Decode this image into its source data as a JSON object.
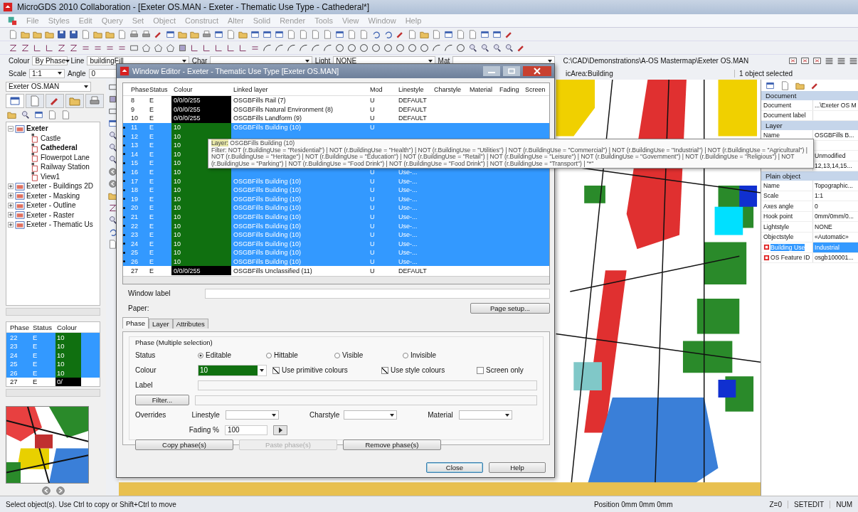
{
  "window": {
    "title": "MicroGDS 2010 Collaboration - [Exeter OS.MAN - Exeter - Thematic Use Type - Cathederal*]"
  },
  "menu": [
    {
      "label": "File",
      "disabled": true
    },
    {
      "label": "Styles",
      "disabled": true
    },
    {
      "label": "Edit",
      "disabled": true
    },
    {
      "label": "Query",
      "disabled": true
    },
    {
      "label": "Set",
      "disabled": true
    },
    {
      "label": "Object",
      "disabled": true
    },
    {
      "label": "Construct",
      "disabled": true
    },
    {
      "label": "Alter",
      "disabled": true
    },
    {
      "label": "Solid",
      "disabled": true
    },
    {
      "label": "Render",
      "disabled": true
    },
    {
      "label": "Tools",
      "disabled": true
    },
    {
      "label": "View",
      "disabled": true
    },
    {
      "label": "Window",
      "disabled": true
    },
    {
      "label": "Help",
      "disabled": true
    }
  ],
  "property_bar": {
    "colour_label": "Colour",
    "colour": "By Phase",
    "line_label": "Line",
    "line": "buildingFill",
    "char_label": "Char",
    "light_label": "Light",
    "light": "NONE",
    "mat_label": "Mat",
    "path": "C:\\CAD\\Demonstrations\\A-OS Mastermap\\Exeter OS.MAN",
    "scale_label": "Scale",
    "scale": "1:1",
    "angle_label": "Angle",
    "angle": "0",
    "context": "icArea:Building",
    "selection": "1 object selected"
  },
  "left_panel": {
    "document": "Exeter OS.MAN",
    "tree": [
      {
        "label": "Exeter",
        "active": true,
        "expanded": true,
        "children": [
          {
            "label": "Castle",
            "active": false
          },
          {
            "label": "Cathederal",
            "active": true
          },
          {
            "label": "Flowerpot Lane",
            "active": false
          },
          {
            "label": "Railway Station",
            "active": false
          },
          {
            "label": "View1",
            "active": false
          }
        ]
      },
      {
        "label": "Exeter - Buildings 2D",
        "active": false,
        "expanded": false
      },
      {
        "label": "Exeter - Masking",
        "active": false,
        "expanded": false
      },
      {
        "label": "Exeter - Outline",
        "active": false,
        "expanded": false
      },
      {
        "label": "Exeter - Raster",
        "active": false,
        "expanded": false
      },
      {
        "label": "Exeter - Thematic Us",
        "active": false,
        "expanded": false
      }
    ]
  },
  "phase_list": {
    "columns": [
      "Phase",
      "Status",
      "Colour"
    ],
    "rows": [
      {
        "phase": "22",
        "status": "E",
        "colour": "10",
        "color": "#107010",
        "selected": true
      },
      {
        "phase": "23",
        "status": "E",
        "colour": "10",
        "color": "#107010",
        "selected": true
      },
      {
        "phase": "24",
        "status": "E",
        "colour": "10",
        "color": "#107010",
        "selected": true
      },
      {
        "phase": "25",
        "status": "E",
        "colour": "10",
        "color": "#107010",
        "selected": true
      },
      {
        "phase": "26",
        "status": "E",
        "colour": "10",
        "color": "#107010",
        "selected": true
      },
      {
        "phase": "27",
        "status": "E",
        "colour": "0/",
        "color": "#000000",
        "selected": false
      }
    ]
  },
  "dialog": {
    "title": "Window Editor - Exeter - Thematic Use Type [Exeter OS.MAN]",
    "columns": [
      "Phase",
      "Status",
      "Colour",
      "Linked layer",
      "Mod",
      "Linestyle",
      "Charstyle",
      "Material",
      "Fading",
      "Screen"
    ],
    "rows": [
      {
        "phase": "8",
        "status": "E",
        "colour": "0/0/0/255",
        "color": "#000000",
        "layer": "OSGBFills Rail (7)",
        "mod": "U",
        "linestyle": "DEFAULT",
        "selected": false
      },
      {
        "phase": "9",
        "status": "E",
        "colour": "0/0/0/255",
        "color": "#000000",
        "layer": "OSGBFills Natural Environment (8)",
        "mod": "U",
        "linestyle": "DEFAULT",
        "selected": false
      },
      {
        "phase": "10",
        "status": "E",
        "colour": "0/0/0/255",
        "color": "#000000",
        "layer": "OSGBFills Landform (9)",
        "mod": "U",
        "linestyle": "DEFAULT",
        "selected": false
      },
      {
        "phase": "11",
        "status": "E",
        "colour": "10",
        "color": "#107010",
        "layer": "OSGBFills Building (10)",
        "mod": "U",
        "selected": true
      },
      {
        "phase": "12",
        "status": "E",
        "colour": "10",
        "color": "#107010",
        "selected": true
      },
      {
        "phase": "13",
        "status": "E",
        "colour": "10",
        "color": "#107010",
        "selected": true
      },
      {
        "phase": "14",
        "status": "E",
        "colour": "10",
        "color": "#107010",
        "selected": true
      },
      {
        "phase": "15",
        "status": "E",
        "colour": "10",
        "color": "#107010",
        "selected": true
      },
      {
        "phase": "16",
        "status": "E",
        "colour": "10",
        "color": "#107010",
        "mod": "U",
        "linestyle": "Use-...",
        "selected": true
      },
      {
        "phase": "17",
        "status": "E",
        "colour": "10",
        "color": "#107010",
        "layer": "OSGBFills Building (10)",
        "mod": "U",
        "linestyle": "Use-...",
        "selected": true
      },
      {
        "phase": "18",
        "status": "E",
        "colour": "10",
        "color": "#107010",
        "layer": "OSGBFills Building (10)",
        "mod": "U",
        "linestyle": "Use-...",
        "selected": true
      },
      {
        "phase": "19",
        "status": "E",
        "colour": "10",
        "color": "#107010",
        "layer": "OSGBFills Building (10)",
        "mod": "U",
        "linestyle": "Use-...",
        "selected": true
      },
      {
        "phase": "20",
        "status": "E",
        "colour": "10",
        "color": "#107010",
        "layer": "OSGBFills Building (10)",
        "mod": "U",
        "linestyle": "Use-...",
        "selected": true
      },
      {
        "phase": "21",
        "status": "E",
        "colour": "10",
        "color": "#107010",
        "layer": "OSGBFills Building (10)",
        "mod": "U",
        "linestyle": "Use-...",
        "selected": true
      },
      {
        "phase": "22",
        "status": "E",
        "colour": "10",
        "color": "#107010",
        "layer": "OSGBFills Building (10)",
        "mod": "U",
        "linestyle": "Use-...",
        "selected": true
      },
      {
        "phase": "23",
        "status": "E",
        "colour": "10",
        "color": "#107010",
        "layer": "OSGBFills Building (10)",
        "mod": "U",
        "linestyle": "Use-...",
        "selected": true
      },
      {
        "phase": "24",
        "status": "E",
        "colour": "10",
        "color": "#107010",
        "layer": "OSGBFills Building (10)",
        "mod": "U",
        "linestyle": "Use-...",
        "selected": true
      },
      {
        "phase": "25",
        "status": "E",
        "colour": "10",
        "color": "#107010",
        "layer": "OSGBFills Building (10)",
        "mod": "U",
        "linestyle": "Use-...",
        "selected": true
      },
      {
        "phase": "26",
        "status": "E",
        "colour": "10",
        "color": "#107010",
        "layer": "OSGBFills Building (10)",
        "mod": "U",
        "linestyle": "Use-...",
        "selected": true
      },
      {
        "phase": "27",
        "status": "E",
        "colour": "0/0/0/255",
        "color": "#000000",
        "layer": "OSGBFills Unclassified (11)",
        "mod": "U",
        "linestyle": "DEFAULT",
        "selected": false
      }
    ],
    "tooltip": {
      "layer_label": "Layer:",
      "layer": "OSGBFills Building (10)",
      "filter": "Filter: NOT (r.BuildingUse = \"Residential\") | NOT (r.BuildingUse = \"Health\") | NOT (r.BuildingUse = \"Utilities\") | NOT (r.BuildingUse = \"Commercial\") | NOT (r.BuildingUse = \"Industrial\") | NOT (r.BuildingUse = \"Agricultural\") | NOT (r.BuildingUse = \"Heritage\") | NOT (r.BuildingUse = \"Education\") | NOT (r.BuildingUse = \"Retail\") | NOT (r.BuildingUse = \"Leisure\") | NOT (r.BuildingUse = \"Government\") | NOT (r.BuildingUse = \"Religious\") | NOT (r.BuildingUse = \"Parking\") | NOT (r.BuildingUse = \"Food Drink\") | NOT (r.BuildingUse = \"Food Drink\") | NOT (r.BuildingUse = \"Transport\") | \"*\""
    },
    "window_label": "Window label",
    "paper_label": "Paper:",
    "page_setup": "Page setup...",
    "tabs": [
      {
        "label": "Phase",
        "selected": true
      },
      {
        "label": "Layer",
        "selected": false
      },
      {
        "label": "Attributes",
        "selected": false
      }
    ],
    "group_title": "Phase (Multiple selection)",
    "status_label": "Status",
    "status_options": [
      {
        "label": "Editable",
        "selected": true
      },
      {
        "label": "Hittable",
        "selected": false
      },
      {
        "label": "Visible",
        "selected": false
      },
      {
        "label": "Invisible",
        "selected": false
      }
    ],
    "colour_label": "Colour",
    "colour": "10",
    "checkboxes": [
      {
        "label": "Use primitive colours",
        "checked": true
      },
      {
        "label": "Use style colours",
        "checked": true
      },
      {
        "label": "Screen only",
        "checked": false
      }
    ],
    "label_label": "Label",
    "filter_button": "Filter...",
    "overrides_label": "Overrides",
    "overrides": [
      {
        "label": "Linestyle"
      },
      {
        "label": "Charstyle"
      },
      {
        "label": "Material"
      }
    ],
    "fading_label": "Fading %",
    "fading": "100",
    "actions": [
      {
        "label": "Copy phase(s)",
        "disabled": false
      },
      {
        "label": "Paste phase(s)",
        "disabled": true
      },
      {
        "label": "Remove phase(s)",
        "disabled": false
      }
    ],
    "footer": [
      {
        "label": "Close",
        "default": true
      },
      {
        "label": "Help",
        "default": false
      }
    ]
  },
  "properties": {
    "sections": [
      {
        "title": "Document",
        "rows": [
          {
            "label": "Document",
            "value": "...\\Exeter OS M",
            "kind": "plain",
            "selected": false
          },
          {
            "label": "Document label",
            "kind": "plain",
            "selected": false
          }
        ]
      },
      {
        "title": "Layer",
        "rows": [
          {
            "label": "Name",
            "value": "OSGBFills B...",
            "kind": "plain",
            "selected": false
          },
          {
            "kind": "plain",
            "selected": false
          },
          {
            "value": "Unmodified",
            "kind": "plain",
            "selected": false
          },
          {
            "value": "12,13,14,15...",
            "kind": "plain",
            "selected": false
          }
        ]
      },
      {
        "title": "Plain object",
        "rows": [
          {
            "label": "Name",
            "value": "Topographic...",
            "kind": "plain",
            "selected": false
          },
          {
            "label": "Scale",
            "value": "1:1",
            "kind": "plain",
            "selected": false
          },
          {
            "label": "Axes angle",
            "value": "0",
            "kind": "plain",
            "selected": false
          },
          {
            "label": "Hook point",
            "value": "0mm/0mm/0...",
            "kind": "plain",
            "selected": false
          },
          {
            "label": "Lightstyle",
            "value": "NONE",
            "kind": "plain",
            "selected": false
          },
          {
            "label": "Objectstyle",
            "value": "«Automatic»",
            "kind": "plain",
            "selected": false
          },
          {
            "label": "Building Use",
            "value": "Industrial",
            "kind": "attribute",
            "selected": true
          },
          {
            "label": "OS Feature ID",
            "value": "osgb100001...",
            "kind": "attribute",
            "selected": false
          }
        ]
      }
    ]
  },
  "status_bar": {
    "prompt": "Select object(s). Use Ctrl to copy or Shift+Ctrl to move",
    "position": "Position 0mm 0mm 0mm",
    "z": "Z=0",
    "mode": "SETEDIT",
    "num": "NUM"
  }
}
